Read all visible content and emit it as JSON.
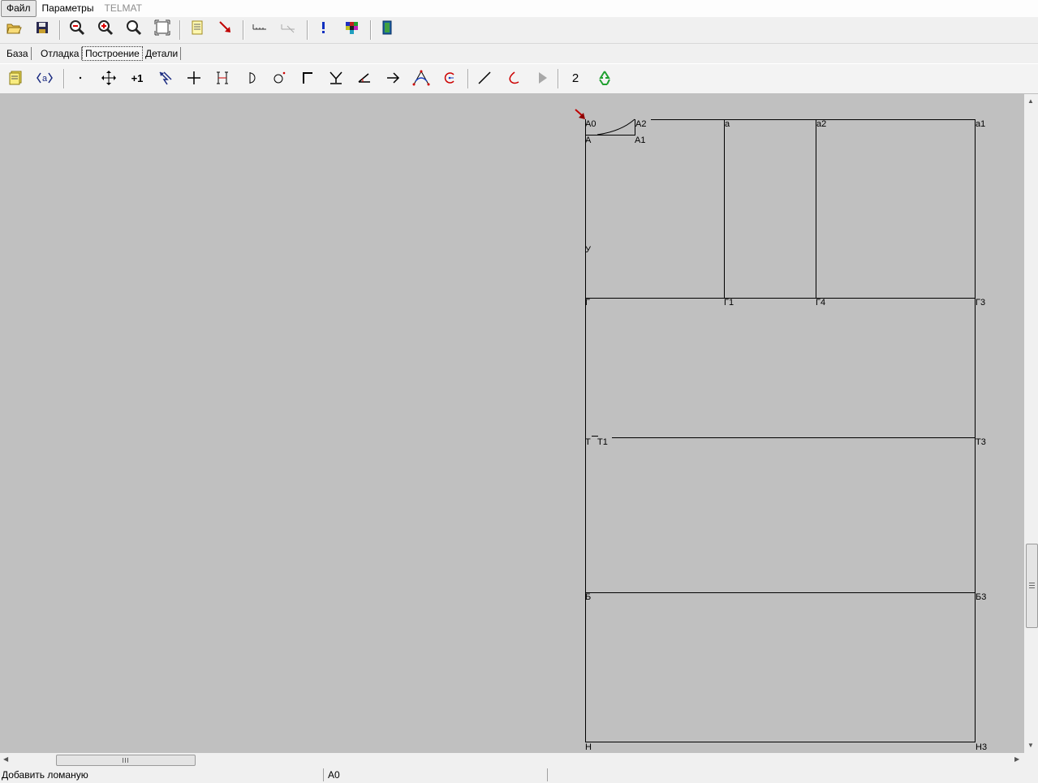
{
  "menubar": {
    "items": [
      {
        "label": "Файл"
      },
      {
        "label": "Параметры"
      },
      {
        "label": "TELMAT"
      }
    ]
  },
  "toolbar_main": {
    "buttons": [
      "open-folder-icon",
      "save-disk-icon",
      "zoom-out-icon",
      "zoom-in-icon",
      "zoom-icon",
      "fit-window-icon",
      "document-icon",
      "pointer-arrow-icon",
      "measure-ruler-icon",
      "measure-ruler-disabled-icon",
      "exclamation-icon",
      "color-palette-icon",
      "exit-door-icon"
    ]
  },
  "tabs": {
    "items": [
      {
        "label": "База"
      },
      {
        "label": "Отладка"
      },
      {
        "label": "Построение"
      },
      {
        "label": "Детали"
      }
    ],
    "active": "Построение"
  },
  "toolbar_build": {
    "label_2": "2",
    "label_plus1": "+1",
    "label_a": "a",
    "buttons": [
      "notes-icon",
      "named-point-icon",
      "point-icon",
      "move-icon",
      "add-one-icon",
      "select-arrows-icon",
      "cross-icon",
      "bracket-icon",
      "half-circle-icon",
      "circle-point-icon",
      "corner-icon",
      "intersect-icon",
      "angle-icon",
      "arrow-right-icon",
      "triangle-curve-icon",
      "arc-circle-icon",
      "line-icon",
      "curve-icon",
      "play-icon",
      "number-two-icon",
      "recycle-icon"
    ]
  },
  "drawing": {
    "points": {
      "A0": "А0",
      "A2": "А2",
      "A": "А",
      "A1": "А1",
      "a": "а",
      "a1": "а1",
      "a2": "а2",
      "U": "У",
      "G": "Г",
      "G1": "Г1",
      "G4": "Г4",
      "G3": "Г3",
      "T": "Т",
      "T1": "Т1",
      "T3": "Т3",
      "B": "Б",
      "B3": "Б3",
      "N": "Н",
      "N3": "Н3"
    }
  },
  "statusbar": {
    "message": "Добавить ломаную",
    "current_point": "А0"
  },
  "colors": {
    "canvas": "#c0c0c0",
    "line": "#000000",
    "marker": "#c00000"
  }
}
